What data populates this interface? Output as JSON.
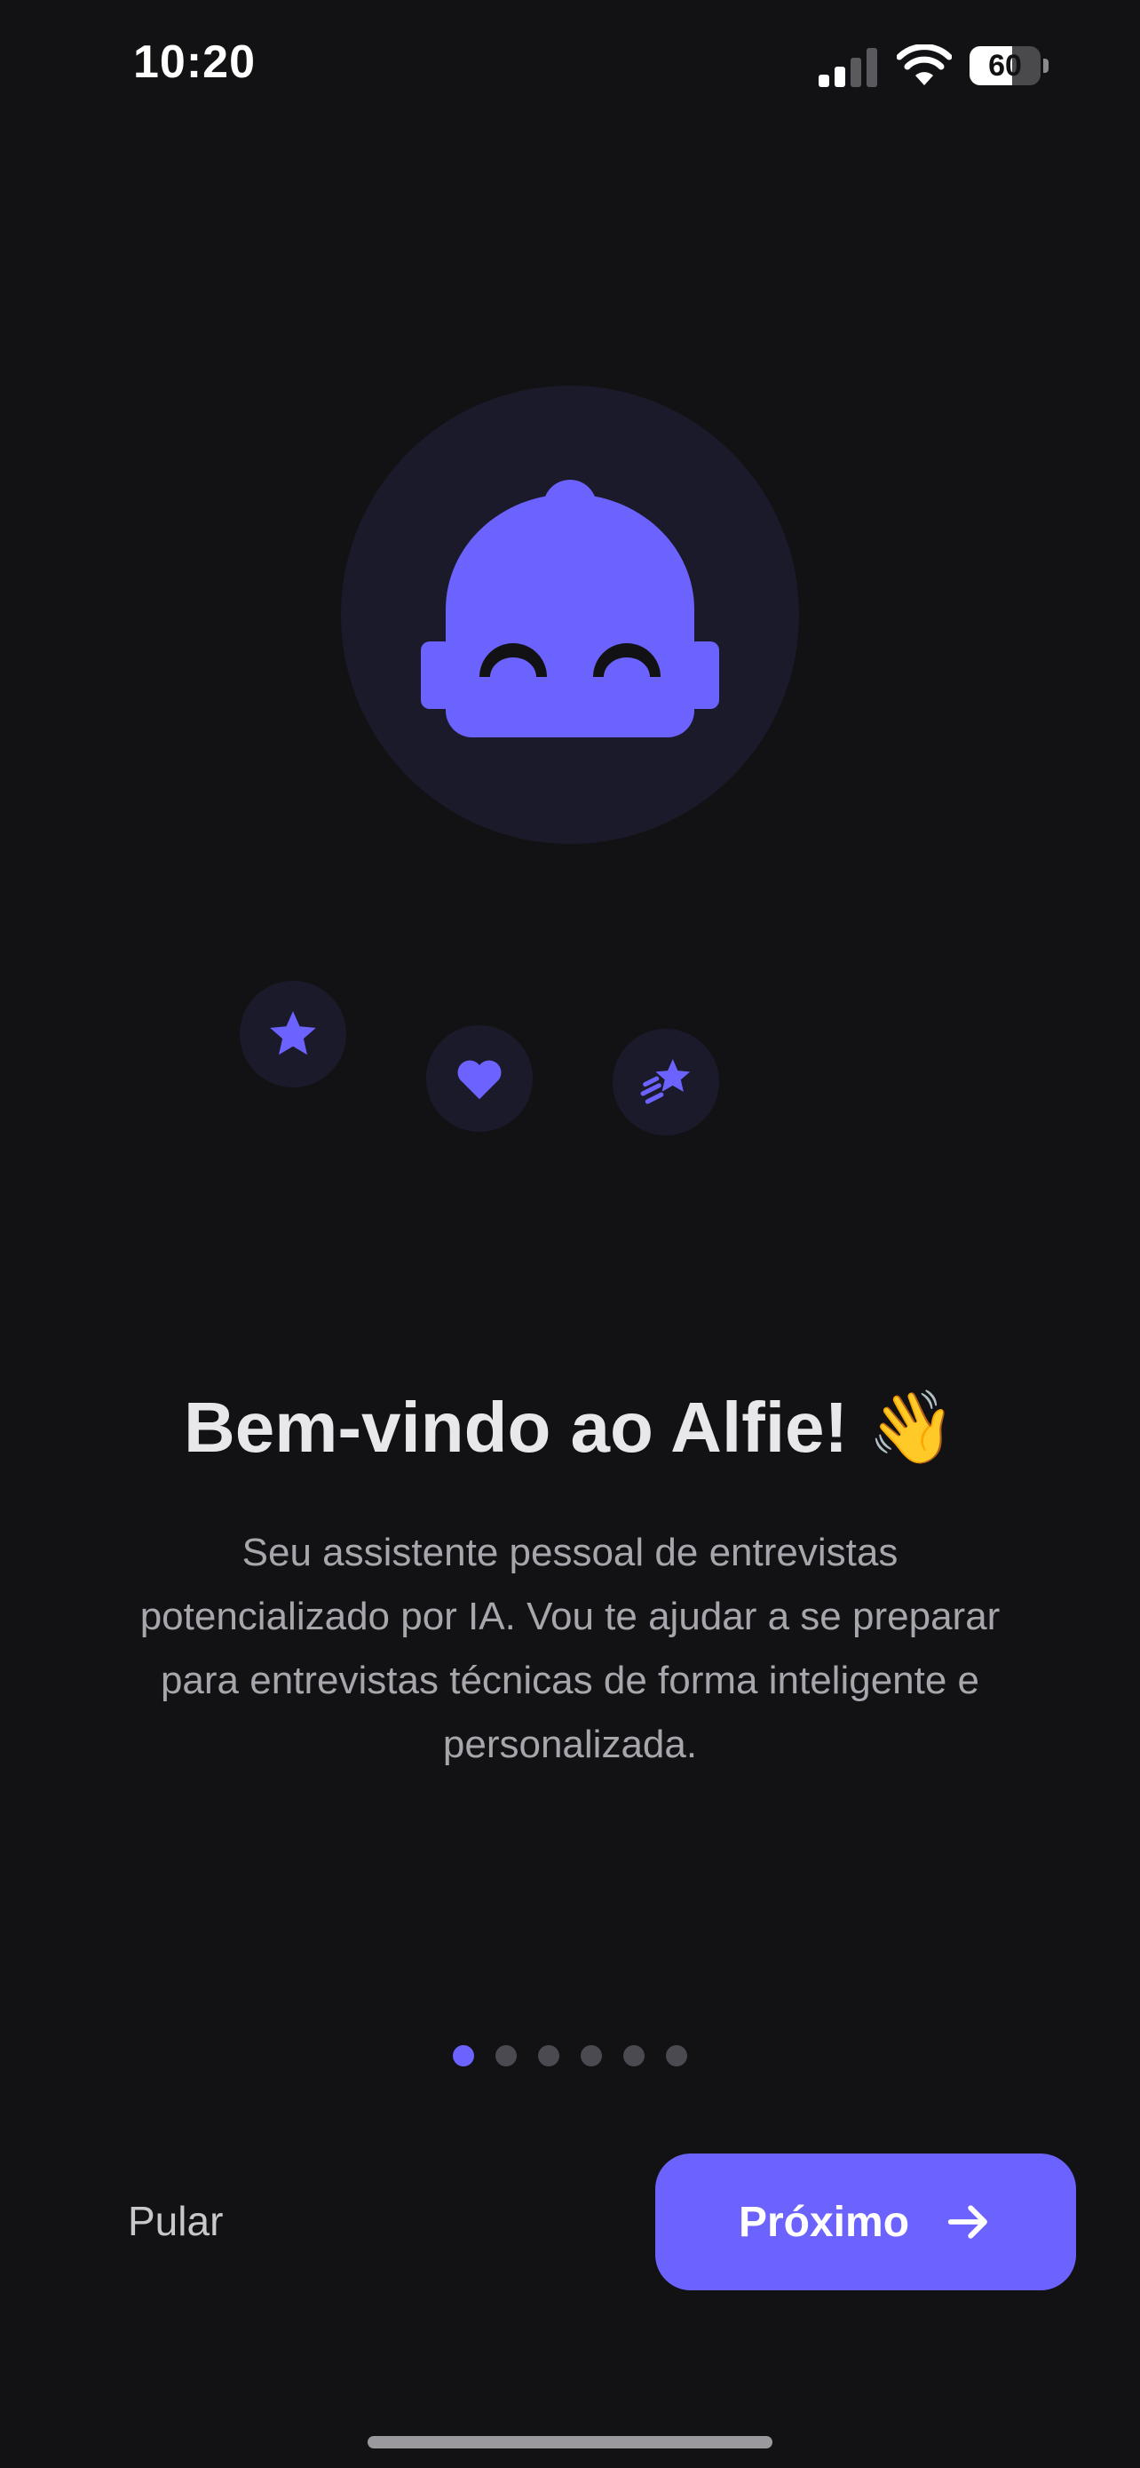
{
  "status_bar": {
    "time": "10:20",
    "battery_level": 60,
    "battery_label": "60",
    "signal_bars_active": 2
  },
  "hero": {
    "main_icon": "robot-icon",
    "badges": [
      {
        "icon": "star-icon"
      },
      {
        "icon": "heart-icon"
      },
      {
        "icon": "shooting-star-icon"
      }
    ]
  },
  "content": {
    "title": "Bem-vindo ao Alfie! 👋",
    "description": "Seu assistente pessoal de entrevistas potencializado por IA. Vou te ajudar a se preparar para entrevistas técnicas de forma inteligente e personalizada."
  },
  "pager": {
    "total": 6,
    "current": 1
  },
  "actions": {
    "skip_label": "Pular",
    "next_label": "Próximo",
    "next_icon": "arrow-right-icon"
  },
  "colors": {
    "background": "#121214",
    "accent": "#6c63ff",
    "circle": "#1b1a2a",
    "text_primary": "#e8e8ea",
    "text_secondary": "#a6a6ac"
  }
}
